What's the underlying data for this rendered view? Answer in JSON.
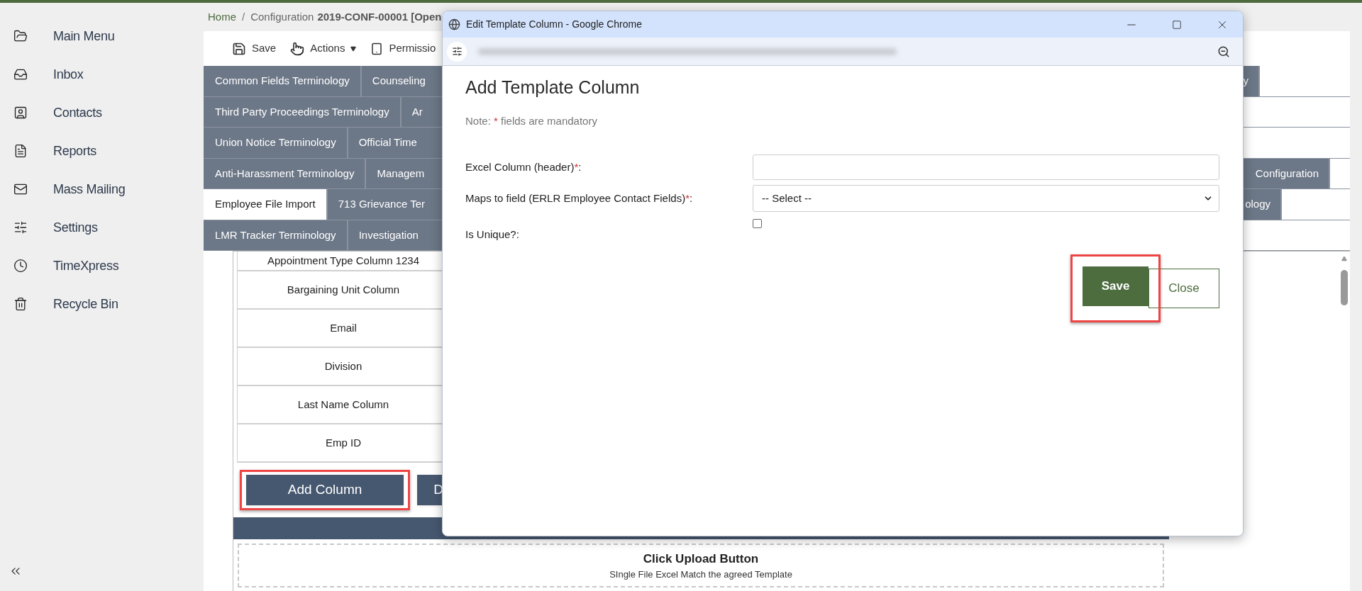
{
  "sidebar": {
    "items": [
      {
        "label": "Main Menu"
      },
      {
        "label": "Inbox"
      },
      {
        "label": "Contacts"
      },
      {
        "label": "Reports"
      },
      {
        "label": "Mass Mailing"
      },
      {
        "label": "Settings"
      },
      {
        "label": "TimeXpress"
      },
      {
        "label": "Recycle Bin"
      }
    ]
  },
  "breadcrumb": {
    "home": "Home",
    "separator": "/",
    "page": "Configuration",
    "record": "2019-CONF-00001 [Open"
  },
  "toolbar": [
    {
      "label": "Save",
      "kind": "save"
    },
    {
      "label": "Actions",
      "kind": "menu"
    },
    {
      "label": "Permissio",
      "kind": "permissions"
    }
  ],
  "tab_rows": [
    {
      "tabs": [
        {
          "label": "Common Fields Terminology",
          "selected": false
        },
        {
          "label": "Counseling",
          "selected": false
        }
      ],
      "right_tab": {
        "label": "y",
        "selected": false
      }
    },
    {
      "tabs": [
        {
          "label": "Third Party Proceedings Terminology",
          "selected": false
        },
        {
          "label": "Ar",
          "selected": false
        }
      ]
    },
    {
      "tabs": [
        {
          "label": "Union Notice Terminology",
          "selected": false
        },
        {
          "label": "Official Time",
          "selected": false
        }
      ]
    },
    {
      "tabs": [
        {
          "label": "Anti-Harassment Terminology",
          "selected": false
        },
        {
          "label": "Managem",
          "selected": false
        }
      ],
      "right_tab": {
        "label": "Configuration",
        "selected": false
      }
    },
    {
      "tabs": [
        {
          "label": "Employee File Import",
          "selected": true
        },
        {
          "label": "713 Grievance Ter",
          "selected": false
        }
      ],
      "right_tab": {
        "label": "ology",
        "selected": false
      }
    },
    {
      "tabs": [
        {
          "label": "LMR Tracker Terminology",
          "selected": false
        },
        {
          "label": "Investigation",
          "selected": false
        }
      ]
    }
  ],
  "table": {
    "rows": [
      "Appointment Type Column 1234",
      "Bargaining Unit Column",
      "Email",
      "Division",
      "Last Name Column",
      "Emp ID"
    ]
  },
  "actions": [
    {
      "label": "Add Column",
      "highlighted": true
    },
    {
      "label": "D",
      "highlighted": false
    }
  ],
  "upload": {
    "title": "Click Upload Button",
    "subtitle": "SIngle File Excel Match the agreed Template"
  },
  "popup": {
    "window_title": "Edit Template Column - Google Chrome",
    "heading": "Add Template Column",
    "note": {
      "prefix": "Note:",
      "mark": "*",
      "text": "fields are mandatory"
    },
    "fields": [
      {
        "kind": "text",
        "label": "Excel Column (header)",
        "mark": "*",
        "suffix": ":"
      },
      {
        "kind": "select",
        "label": "Maps to field (ERLR Employee Contact Fields)",
        "mark": "*",
        "suffix": ":",
        "value": "-- Select --"
      },
      {
        "kind": "checkbox",
        "label": "Is Unique?:",
        "checked": false
      }
    ],
    "buttons": [
      {
        "label": "Save",
        "kind": "primary",
        "highlighted": true
      },
      {
        "label": "Close",
        "kind": "secondary",
        "highlighted": false
      }
    ]
  }
}
